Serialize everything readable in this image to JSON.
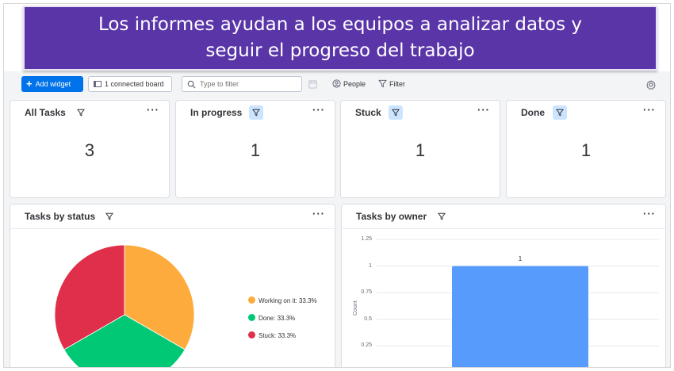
{
  "banner": {
    "line1": "Los informes ayudan a los equipos a analizar datos y",
    "line2": "seguir el progreso del trabajo"
  },
  "toolbar": {
    "add_widget_label": "Add widget",
    "connected_board_label": "1 connected board",
    "filter_placeholder": "Type to filter",
    "people_label": "People",
    "filter_label": "Filter"
  },
  "cards": [
    {
      "title": "All Tasks",
      "value": "3",
      "filter_active": false
    },
    {
      "title": "In progress",
      "value": "1",
      "filter_active": true
    },
    {
      "title": "Stuck",
      "value": "1",
      "filter_active": true
    },
    {
      "title": "Done",
      "value": "1",
      "filter_active": true
    }
  ],
  "more_menu_label": "···",
  "status_widget": {
    "title": "Tasks by status",
    "legend": [
      {
        "label": "Working on it: 33.3%",
        "color": "#fdab3d"
      },
      {
        "label": "Done: 33.3%",
        "color": "#00c875"
      },
      {
        "label": "Stuck: 33.3%",
        "color": "#df2f4a"
      }
    ]
  },
  "owner_widget": {
    "title": "Tasks by owner"
  },
  "chart_data": [
    {
      "type": "pie",
      "categories": [
        "Working on it",
        "Done",
        "Stuck"
      ],
      "values": [
        33.3,
        33.3,
        33.3
      ],
      "colors": [
        "#fdab3d",
        "#00c875",
        "#df2f4a"
      ]
    },
    {
      "type": "bar",
      "categories": [
        ""
      ],
      "values": [
        1
      ],
      "data_labels": [
        "1"
      ],
      "ylabel": "Count",
      "yticks": [
        "1.25",
        "1",
        "0.75",
        "0.5",
        "0.25"
      ],
      "ylim": [
        0,
        1.25
      ],
      "color": "#579bfc",
      "grid": true
    }
  ]
}
